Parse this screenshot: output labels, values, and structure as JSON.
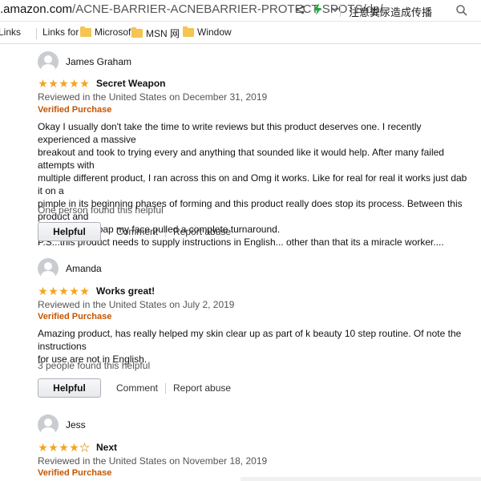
{
  "browser": {
    "url_host": ".amazon.com",
    "url_path": "/ACNE-BARRIER-ACNEBARRIER-PROTECT-SPOTS/dp/",
    "search_text": "注意粪尿造成传播",
    "icons": [
      "share-icon",
      "bolt-icon",
      "chevron-down-icon",
      "search-icon"
    ],
    "accent_color": "#1faa39"
  },
  "bookmarks": [
    {
      "label": "Links",
      "icon": "folder-icon"
    },
    {
      "label": "Links for",
      "icon": "folder-icon"
    },
    {
      "label": "Microsof",
      "icon": "folder-icon"
    },
    {
      "label": "MSN 网",
      "icon": "folder-icon"
    },
    {
      "label": "Window",
      "icon": "folder-icon"
    }
  ],
  "reviews": [
    {
      "reviewer": "James Graham",
      "rating": 5,
      "title": "Secret Weapon",
      "meta": "Reviewed in the United States on December 31, 2019",
      "verified": "Verified Purchase",
      "body": [
        "Okay I usually don't take the time to write reviews but this product deserves one. I recently experienced a massive",
        "breakout and took to trying every and anything that sounded like it would help. After many failed attempts with",
        "multiple different product, I ran across this on and Omg it works. Like for real for real it works just dab it on a",
        "pimple in its beginning phases of forming and this product really does stop its process. Between this product and",
        "tumeric face soap my face pulled a complete turnaround.",
        "P.S...this product needs to supply instructions in English... other than that its a miracle worker...."
      ],
      "helpful_count": "One person found this helpful",
      "helpful_label": "Helpful",
      "comment_label": "Comment",
      "report_label": "Report abuse"
    },
    {
      "reviewer": "Amanda",
      "rating": 5,
      "title": "Works great!",
      "meta": "Reviewed in the United States on July 2, 2019",
      "verified": "Verified Purchase",
      "body": [
        "Amazing product, has really helped my skin clear up as part of k beauty 10 step routine. Of note the instructions",
        "for use are not in English."
      ],
      "helpful_count": "3 people found this helpful",
      "helpful_label": "Helpful",
      "comment_label": "Comment",
      "report_label": "Report abuse"
    },
    {
      "reviewer": "Jess",
      "rating": 4,
      "title": "Next",
      "meta": "Reviewed in the United States on November 18, 2019",
      "verified": "Verified Purchase"
    }
  ],
  "colors": {
    "star": "#f4a41c",
    "verified": "#c45500",
    "folder": "#f5c451"
  }
}
